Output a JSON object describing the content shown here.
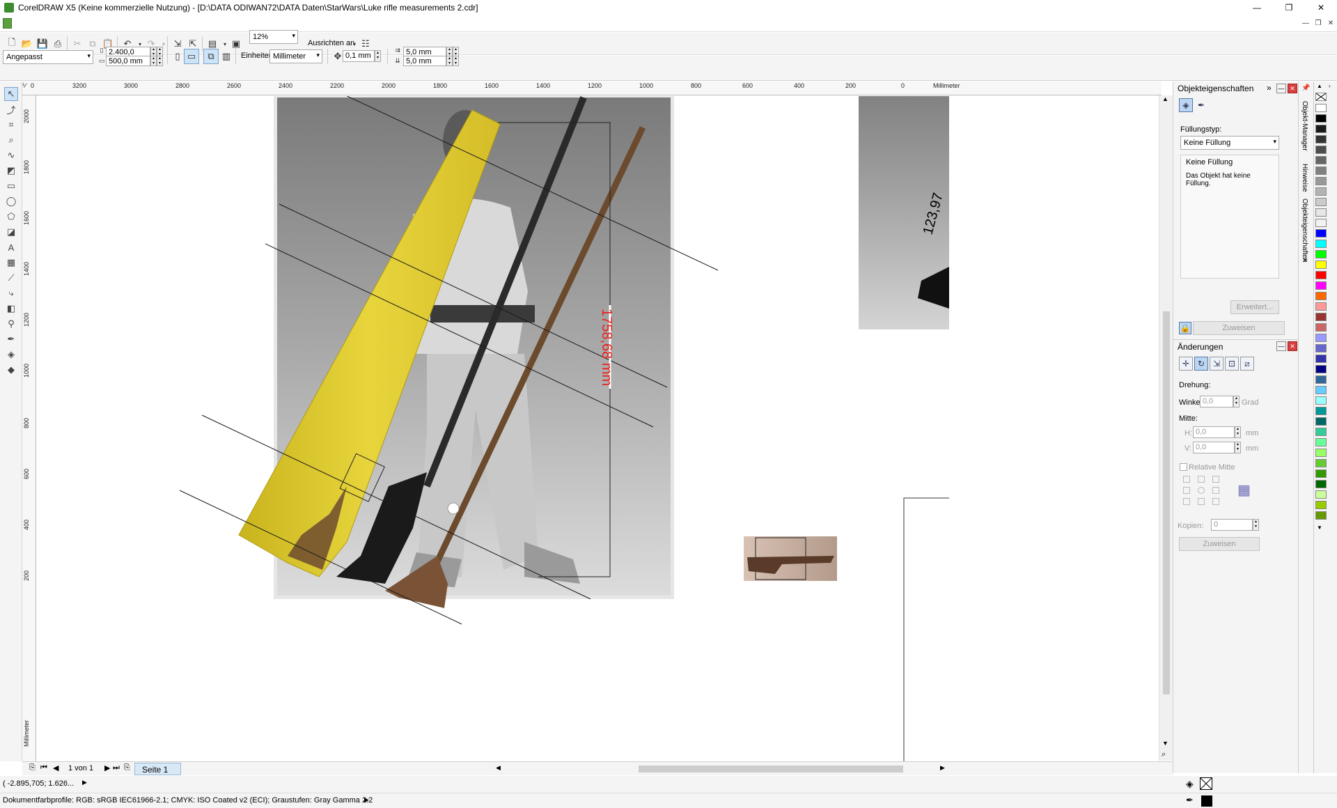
{
  "window": {
    "title": "CorelDRAW X5 (Keine kommerzielle Nutzung) - [D:\\DATA ODIWAN72\\DATA Daten\\StarWars\\Luke rifle measurements 2.cdr]",
    "minimize": "—",
    "maximize": "❐",
    "close": "✕"
  },
  "mdi": {
    "minimize": "—",
    "restore": "❐",
    "close": "✕"
  },
  "toolbar": {
    "zoom": "12%",
    "snap_label": "Ausrichten an",
    "icons": [
      "new-icon",
      "open-icon",
      "save-icon",
      "print-icon",
      "cut-icon",
      "copy-icon",
      "paste-icon",
      "undo-icon",
      "redo-icon",
      "import-icon",
      "export-icon",
      "publish-icon",
      "fullscreen-icon",
      "options-icon"
    ]
  },
  "property_bar": {
    "paper_preset": "Angepasst",
    "page_width": "2.400,0 mm",
    "page_height": "500,0 mm",
    "units_label": "Einheiten:",
    "units_value": "Millimeter",
    "nudge": "0,1 mm",
    "dup_x": "5,0 mm",
    "dup_y": "5,0 mm"
  },
  "tools": [
    "pick-tool-icon",
    "shape-tool-icon",
    "crop-tool-icon",
    "zoom-tool-icon",
    "freehand-tool-icon",
    "smart-fill-icon",
    "rectangle-tool-icon",
    "ellipse-tool-icon",
    "polygon-tool-icon",
    "basic-shapes-icon",
    "text-tool-icon",
    "table-tool-icon",
    "dimension-tool-icon",
    "connector-tool-icon",
    "blend-tool-icon",
    "eyedropper-tool-icon",
    "outline-tool-icon",
    "fill-tool-icon",
    "interactive-fill-icon"
  ],
  "hruler": {
    "unit": "Millimeter",
    "ticks": [
      "3200",
      "3000",
      "2800",
      "2600",
      "2400",
      "2200",
      "2000",
      "1800",
      "1600",
      "1400",
      "1200",
      "1000",
      "800",
      "600",
      "400",
      "200",
      "0"
    ]
  },
  "vruler": {
    "unit": "Millimeter",
    "ticks": [
      "2000",
      "1800",
      "1600",
      "1400",
      "1200",
      "1000",
      "800",
      "600",
      "400",
      "200"
    ]
  },
  "canvas": {
    "dimension_text": "1758,68 mm",
    "dimension_color": "#e8201c",
    "right_dimension_text": "123,97",
    "ruler_strip_color": "#e8d53c"
  },
  "page_nav": {
    "page_count": "1 von 1",
    "page_tab": "Seite 1"
  },
  "status": {
    "coordinates": "( -2.895,705; 1.626... ",
    "color_profiles": "Dokumentfarbprofile: RGB: sRGB IEC61966-2.1; CMYK: ISO Coated v2 (ECI); Graustufen: Gray Gamma 2.2"
  },
  "docker_props": {
    "title": "Objekteigenschaften",
    "fill_type_label": "Füllungstyp:",
    "fill_type_value": "Keine Füllung",
    "info_title": "Keine Füllung",
    "info_text": "Das Objekt hat keine Füllung.",
    "advanced_button": "Erweitert...",
    "apply_button": "Zuweisen"
  },
  "docker_transform": {
    "title": "Änderungen",
    "rotation_label": "Drehung:",
    "angle_label": "Winkel:",
    "angle_value": "0,0",
    "angle_unit": "Grad",
    "center_label": "Mitte:",
    "h_label": "H:",
    "h_value": "0,0",
    "h_unit": "mm",
    "v_label": "V:",
    "v_value": "0,0",
    "v_unit": "mm",
    "relative_label": "Relative Mitte",
    "copies_label": "Kopien:",
    "copies_value": "0",
    "apply_button": "Zuweisen"
  },
  "side_tabs": [
    "Objekt-Manager",
    "Hinweise",
    "Objekteigenschaften"
  ],
  "palette": [
    "#ffffff",
    "#000000",
    "#1a1a1a",
    "#333333",
    "#4d4d4d",
    "#666666",
    "#808080",
    "#999999",
    "#b3b3b3",
    "#cccccc",
    "#e6e6e6",
    "#f2f2f2",
    "#0000ff",
    "#00ffff",
    "#00ff00",
    "#ffff00",
    "#ff0000",
    "#ff00ff",
    "#ff6600",
    "#ff9999",
    "#993333",
    "#cc6666",
    "#9999ff",
    "#6666cc",
    "#3333aa",
    "#000080",
    "#336699",
    "#66ccff",
    "#99ffff",
    "#009999",
    "#006666",
    "#33cc99",
    "#66ff99",
    "#99ff66",
    "#66cc33",
    "#339900",
    "#006600",
    "#ccff99",
    "#99cc00",
    "#669900"
  ]
}
